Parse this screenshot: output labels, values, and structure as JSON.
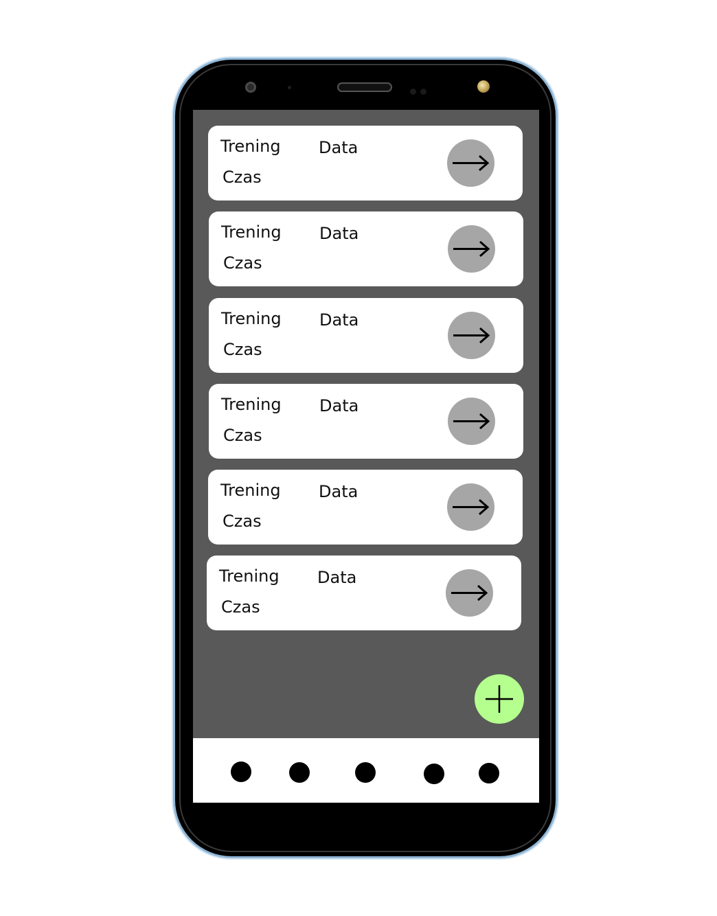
{
  "trainings": [
    {
      "name": "Trening",
      "date": "Data",
      "time": "Czas"
    },
    {
      "name": "Trening",
      "date": "Data",
      "time": "Czas"
    },
    {
      "name": "Trening",
      "date": "Data",
      "time": "Czas"
    },
    {
      "name": "Trening",
      "date": "Data",
      "time": "Czas"
    },
    {
      "name": "Trening",
      "date": "Data",
      "time": "Czas"
    },
    {
      "name": "Trening",
      "date": "Data",
      "time": "Czas"
    }
  ],
  "icons": {
    "open": "arrow-right-icon",
    "add": "plus-icon",
    "nav": "dot-icon"
  },
  "colors": {
    "screen_background": "#595959",
    "card_background": "#ffffff",
    "open_button": "#a6a6a6",
    "add_button": "#b4ff8e",
    "nav_dot": "#000000"
  }
}
